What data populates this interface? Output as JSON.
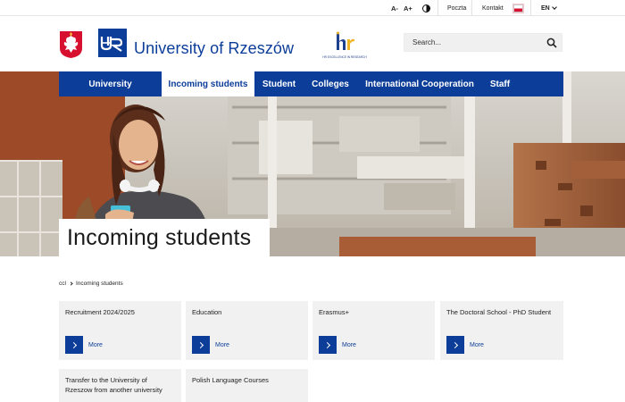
{
  "topbar": {
    "font_decrease": "A-",
    "font_increase": "A+",
    "contrast_icon": "contrast-icon",
    "mail_label": "Poczta",
    "contact_label": "Kontakt",
    "flag_icon": "polish-flag-icon",
    "language": "EN"
  },
  "header": {
    "emblem_icon": "polish-eagle-emblem",
    "logo_icon": "ur-logo",
    "university_name": "University of Rzeszów",
    "hr_logo_text": "HR EXCELLENCE IN RESEARCH",
    "search": {
      "placeholder": "Search..."
    }
  },
  "nav": {
    "items": [
      {
        "label": "University",
        "active": false
      },
      {
        "label": "Incoming students",
        "active": true
      },
      {
        "label": "Student",
        "active": false
      },
      {
        "label": "Colleges",
        "active": false
      },
      {
        "label": "International Cooperation",
        "active": false
      },
      {
        "label": "Staff",
        "active": false
      }
    ]
  },
  "hero": {
    "title": "Incoming students"
  },
  "breadcrumb": {
    "items": [
      "ccl",
      "Incoming students"
    ]
  },
  "cards": [
    {
      "title": "Recruitment 2024/2025",
      "more": "More"
    },
    {
      "title": "Education",
      "more": "More"
    },
    {
      "title": "Erasmus+",
      "more": "More"
    },
    {
      "title": "The Doctoral School - PhD Student",
      "more": "More"
    },
    {
      "title": "Transfer to the University of Rzeszow from another university",
      "more": ""
    },
    {
      "title": "Polish Language Courses",
      "more": ""
    }
  ],
  "colors": {
    "primary": "#0c3d99",
    "card_bg": "#f1f1f1",
    "flag_red": "#d8102f"
  }
}
